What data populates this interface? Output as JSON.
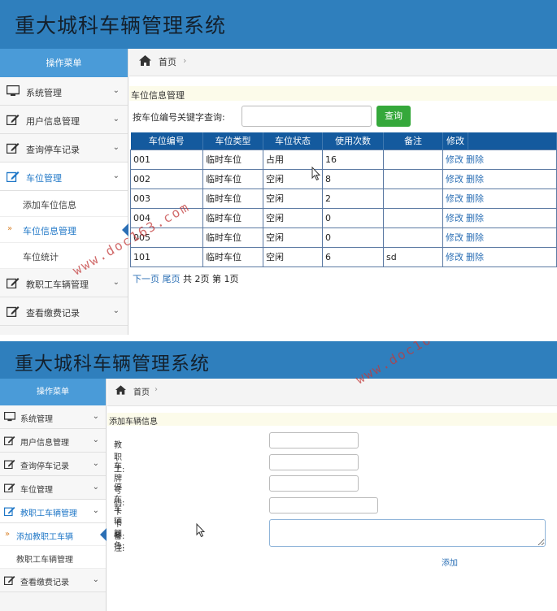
{
  "app": {
    "title": "重大城科车辆管理系统"
  },
  "sidebar": {
    "header": "操作菜单",
    "items": [
      {
        "label": "系统管理",
        "icon": "monitor-icon"
      },
      {
        "label": "用户信息管理",
        "icon": "edit-icon"
      },
      {
        "label": "查询停车记录",
        "icon": "edit-icon"
      },
      {
        "label": "车位管理",
        "icon": "edit-icon"
      },
      {
        "label": "教职工车辆管理",
        "icon": "edit-icon"
      },
      {
        "label": "查看缴费记录",
        "icon": "edit-icon"
      }
    ],
    "parking_sub": [
      "添加车位信息",
      "车位信息管理",
      "车位统计"
    ],
    "vehicle_sub": [
      "添加教职工车辆",
      "教职工车辆管理"
    ],
    "active_marker": "»"
  },
  "breadcrumb": {
    "home": "首页",
    "sep": "›"
  },
  "page1": {
    "panel_title": "车位信息管理",
    "search": {
      "label": "按车位编号关键字查询:",
      "value": "",
      "button": "查询"
    },
    "columns": [
      "车位编号",
      "车位类型",
      "车位状态",
      "使用次数",
      "备注",
      "修改"
    ],
    "rows": [
      [
        "001",
        "临时车位",
        "占用",
        "16",
        ""
      ],
      [
        "002",
        "临时车位",
        "空闲",
        "8",
        ""
      ],
      [
        "003",
        "临时车位",
        "空闲",
        "2",
        ""
      ],
      [
        "004",
        "临时车位",
        "空闲",
        "0",
        ""
      ],
      [
        "005",
        "临时车位",
        "空闲",
        "0",
        ""
      ],
      [
        "101",
        "临时车位",
        "空闲",
        "6",
        "sd"
      ]
    ],
    "row_actions": {
      "edit": "修改",
      "delete": "删除"
    },
    "pager": {
      "next": "下一页",
      "last": "尾页",
      "summary": "共 2页 第 1页"
    }
  },
  "page2": {
    "panel_title": "添加车辆信息",
    "fields": [
      {
        "label": "教职工:",
        "value": ""
      },
      {
        "label": "车牌号码:",
        "value": ""
      },
      {
        "label": "停车卡卡号:",
        "value": ""
      },
      {
        "label": "车辆颜色:",
        "value": ""
      },
      {
        "label": "备注:",
        "value": ""
      }
    ],
    "submit": "添加"
  },
  "watermark": "www.doc163.com",
  "colors": {
    "header": "#2f7fbd",
    "menu_head": "#4a9bd8",
    "table_head": "#145a9e",
    "search_button": "#35a83b",
    "link": "#2b6fb5"
  }
}
